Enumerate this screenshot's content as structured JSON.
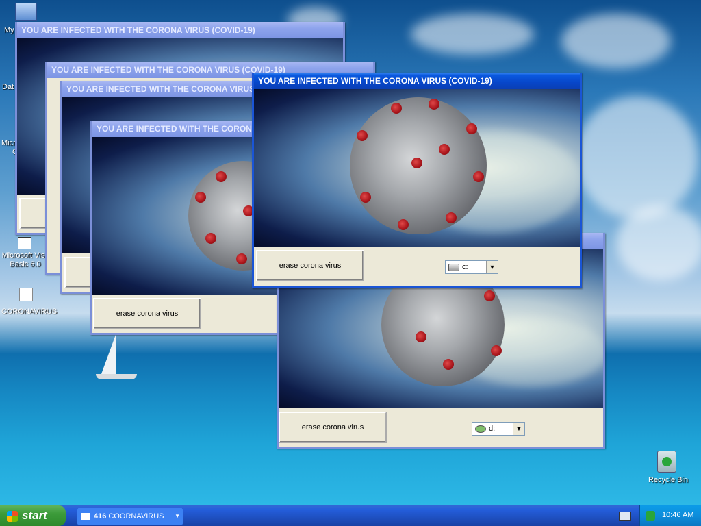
{
  "desktop": {
    "icons": [
      {
        "name": "my-computer",
        "label": "My"
      },
      {
        "name": "data",
        "label": "Dat"
      },
      {
        "name": "microsoft",
        "label": "Micro"
      },
      {
        "name": "microsoft-extra",
        "label": "C"
      },
      {
        "name": "vb6",
        "label": "Microsoft Visu\nBasic 6.0"
      },
      {
        "name": "coronavirus-folder",
        "label": "CORONAVIRUS"
      },
      {
        "name": "recycle-bin",
        "label": "Recycle Bin"
      }
    ]
  },
  "windows": {
    "title": "YOU ARE INFECTED WITH THE CORONA VIRUS (COVID-19)",
    "erase_label": "erase corona virus",
    "drive_c": "c:",
    "drive_d": "d:",
    "partial_erase": "e"
  },
  "taskbar": {
    "start_label": "start",
    "task_count": "416",
    "task_label": "COORNAVIRUS",
    "clock": "10:46 AM"
  },
  "colors": {
    "title_active": "#0a5ae0",
    "title_inactive": "#8da3ec",
    "window_body": "#ece9d8",
    "taskbar": "#245edb",
    "start_green": "#3c9b3a"
  }
}
